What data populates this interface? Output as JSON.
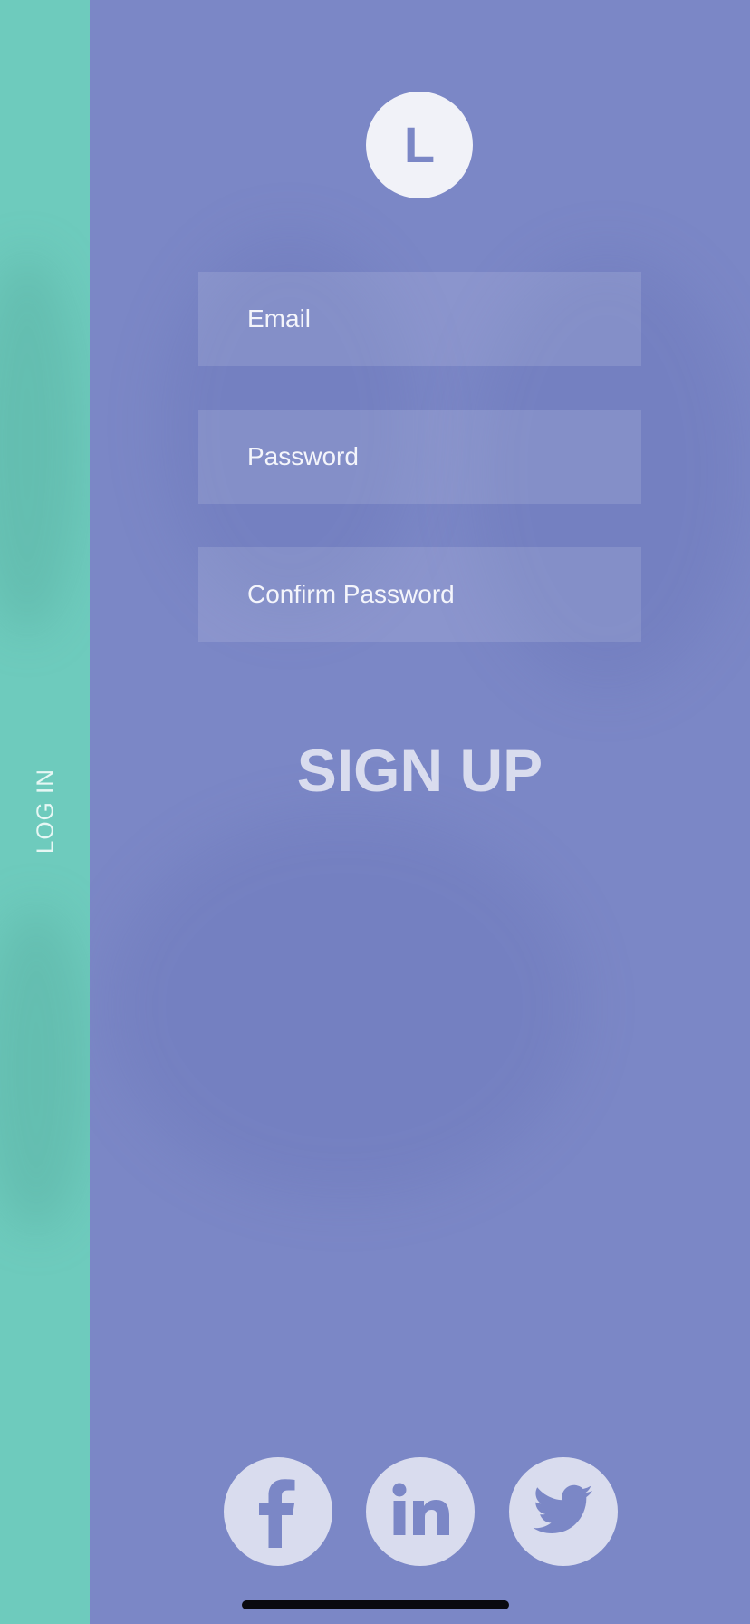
{
  "sidebar": {
    "login_label": "LOG IN",
    "color": "#6ecbbd"
  },
  "logo": {
    "letter": "L"
  },
  "form": {
    "email_placeholder": "Email",
    "password_placeholder": "Password",
    "confirm_password_placeholder": "Confirm Password",
    "submit_label": "SIGN UP"
  },
  "social": [
    {
      "icon": "facebook-icon"
    },
    {
      "icon": "linkedin-icon"
    },
    {
      "icon": "twitter-icon"
    }
  ],
  "colors": {
    "background": "#7b87c6",
    "accent": "#6ecbbd",
    "button_fill": "#d9dcee"
  }
}
